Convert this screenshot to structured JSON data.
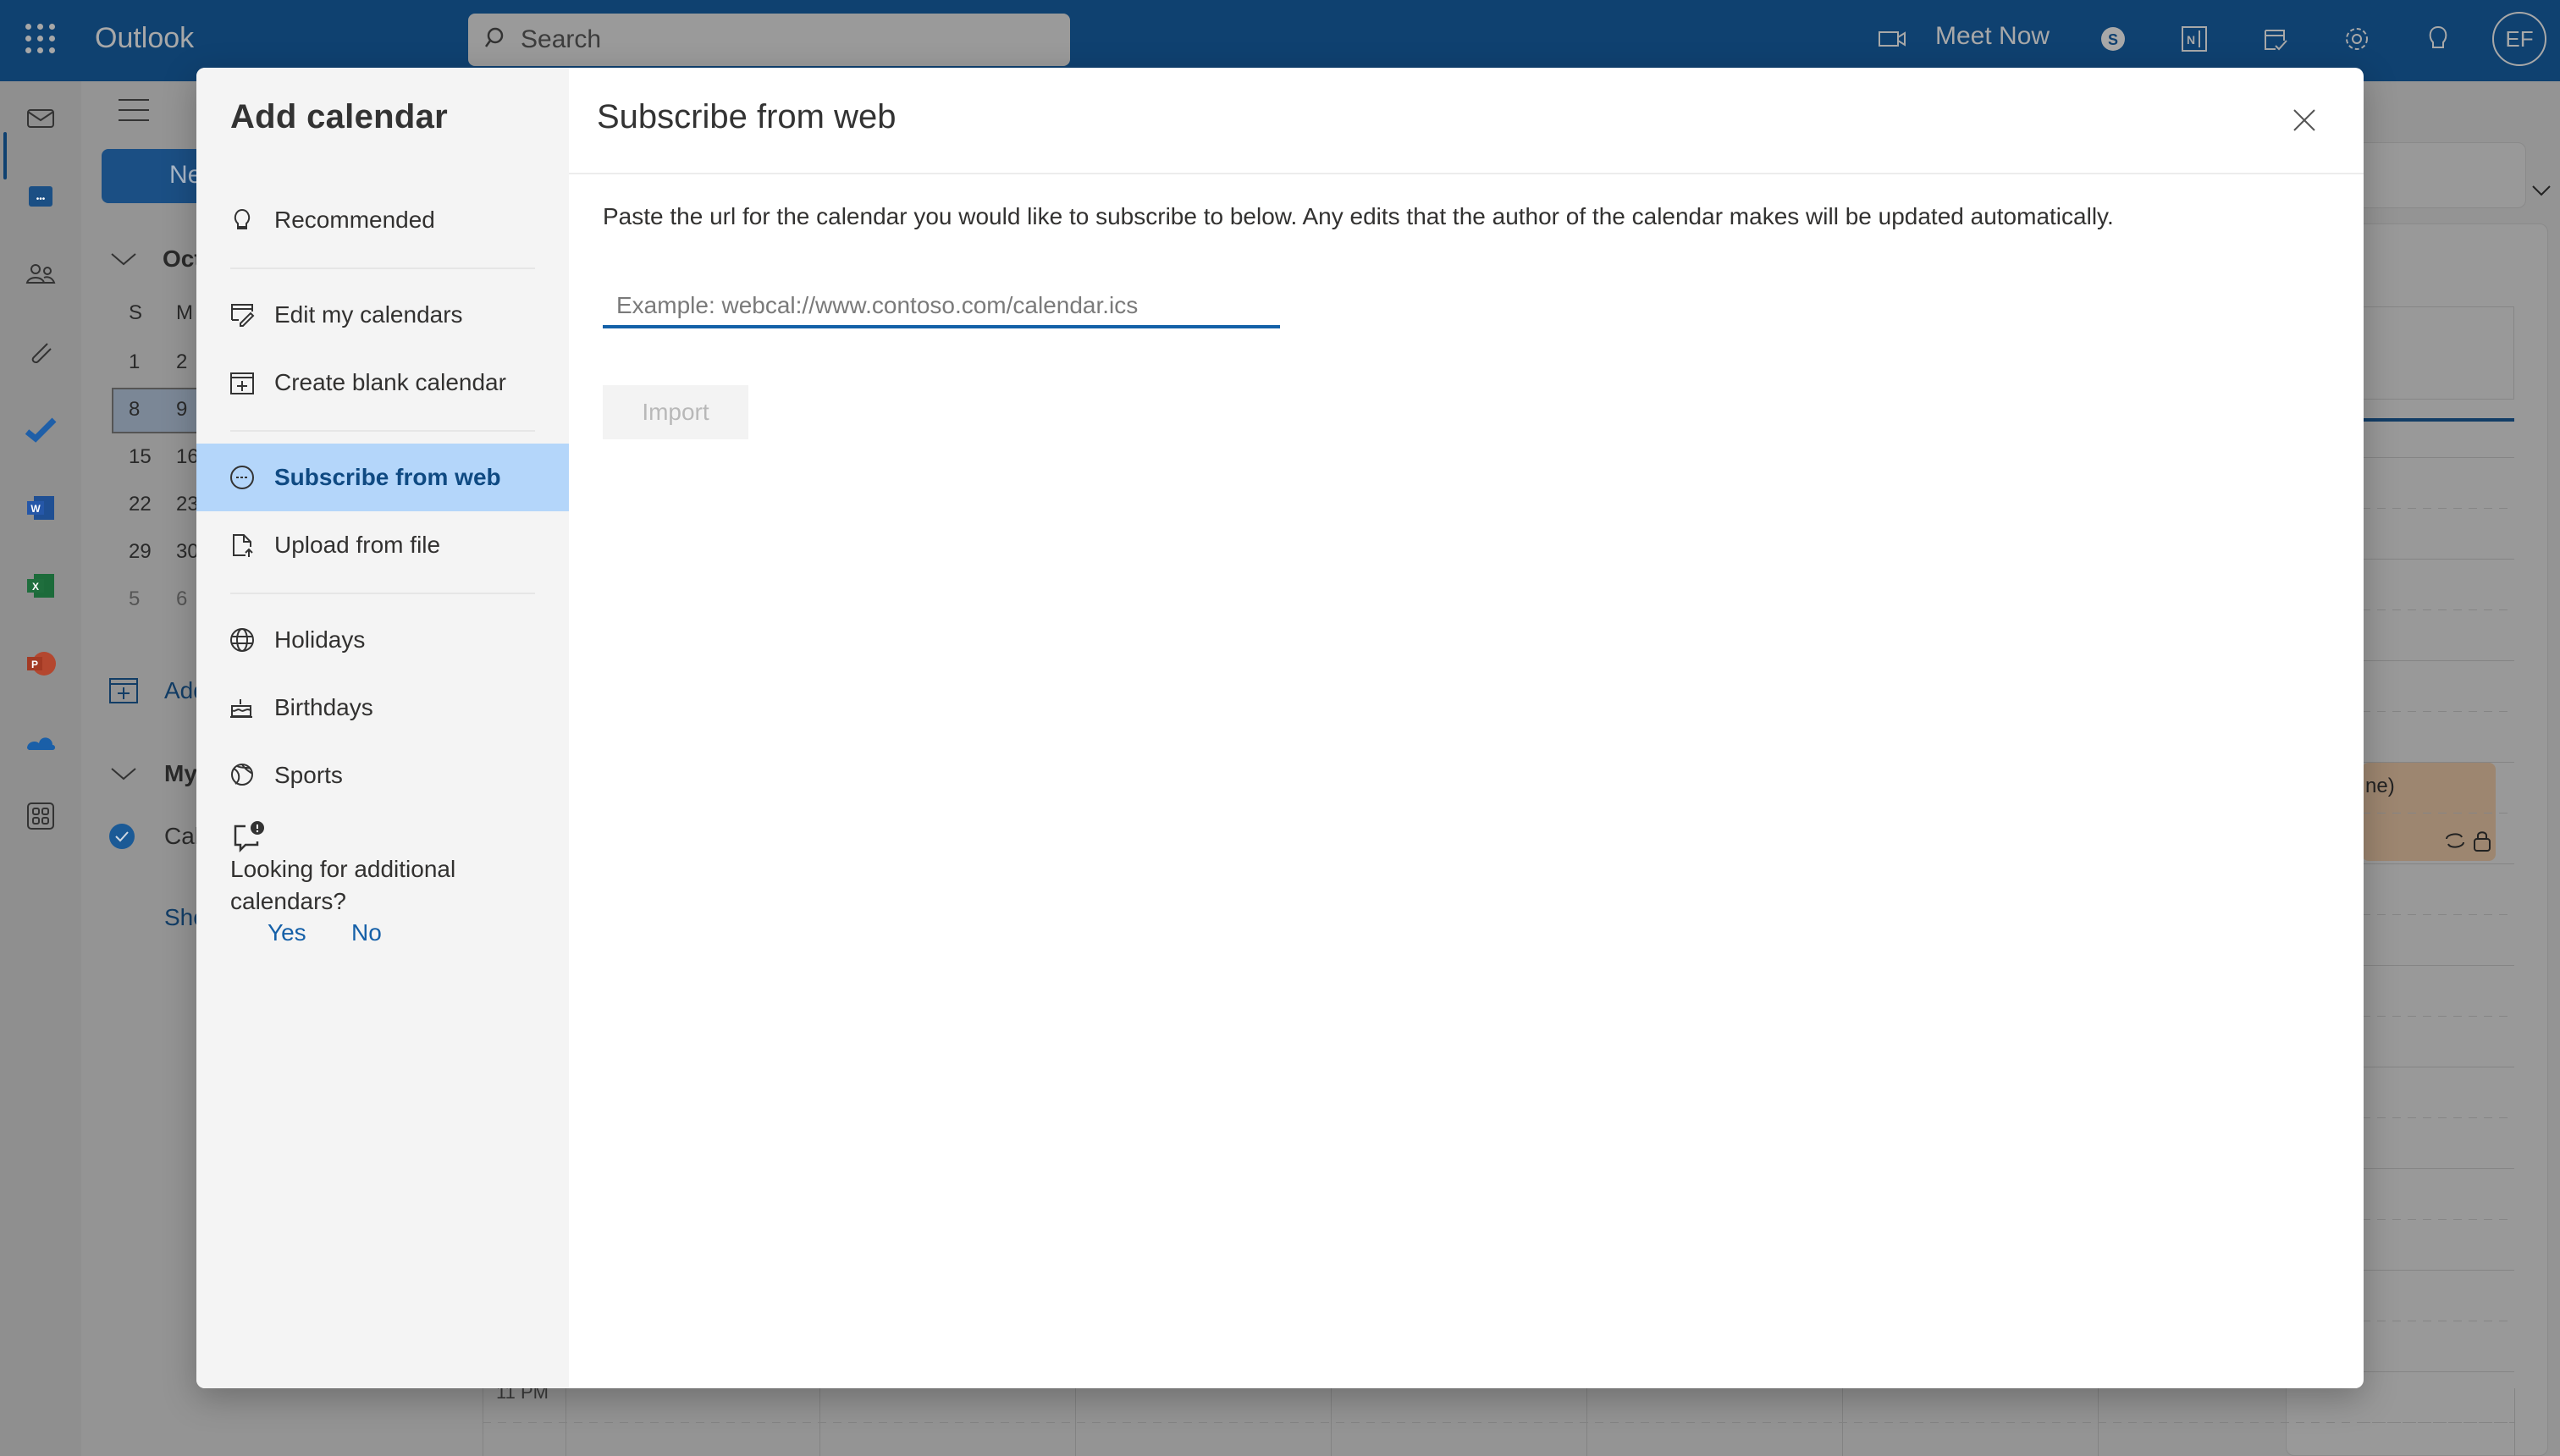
{
  "topbar": {
    "app_name": "Outlook",
    "search_label": "Search",
    "meet_now_label": "Meet Now",
    "avatar_initials": "EF",
    "icons": [
      "app-launcher-icon",
      "search-icon",
      "video-camera-icon",
      "skype-icon",
      "onenote-icon",
      "my-day-icon",
      "settings-icon",
      "tips-lightbulb-icon"
    ]
  },
  "background": {
    "new_event_label": "Ne",
    "month_label": "Oct",
    "weekday_headers": [
      "S",
      "M"
    ],
    "mini_calendar_rows": [
      [
        "1",
        "2"
      ],
      [
        "8",
        "9"
      ],
      [
        "15",
        "16"
      ],
      [
        "22",
        "23"
      ],
      [
        "29",
        "30"
      ],
      [
        "5",
        "6"
      ]
    ],
    "selected_week_index": 1,
    "add_calendar_label": "Add",
    "my_calendars_label": "My",
    "calendar_item_label": "Cal",
    "show_all_label": "Sho",
    "time_label": "11 PM",
    "event_text_fragment": "ne)",
    "rail_icons": [
      "mail-icon",
      "calendar-icon",
      "people-icon",
      "files-icon",
      "todo-icon",
      "word-icon",
      "excel-icon",
      "powerpoint-icon",
      "onedrive-icon",
      "more-apps-icon"
    ]
  },
  "modal": {
    "sidebar_title": "Add calendar",
    "nav_items": [
      {
        "label": "Recommended",
        "icon": "lightbulb-icon"
      },
      {
        "label": "Edit my calendars",
        "icon": "edit-calendar-icon"
      },
      {
        "label": "Create blank calendar",
        "icon": "calendar-add-icon"
      },
      {
        "label": "Subscribe from web",
        "icon": "web-link-icon",
        "active": true
      },
      {
        "label": "Upload from file",
        "icon": "file-upload-icon"
      },
      {
        "label": "Holidays",
        "icon": "globe-icon"
      },
      {
        "label": "Birthdays",
        "icon": "cake-icon"
      },
      {
        "label": "Sports",
        "icon": "sports-ball-icon"
      }
    ],
    "feedback": {
      "question": "Looking for additional calendars?",
      "yes_label": "Yes",
      "no_label": "No"
    },
    "heading": "Subscribe from web",
    "description": "Paste the url for the calendar you would like to subscribe to below. Any edits that the author of the calendar makes will be updated automatically.",
    "url_input": {
      "value": "",
      "placeholder": "Example: webcal://www.contoso.com/calendar.ics"
    },
    "import_label": "Import",
    "import_enabled": false,
    "colors": {
      "accent": "#1461a8",
      "active_nav_bg": "#b4d6fa",
      "header_bg": "#0f4170"
    }
  }
}
